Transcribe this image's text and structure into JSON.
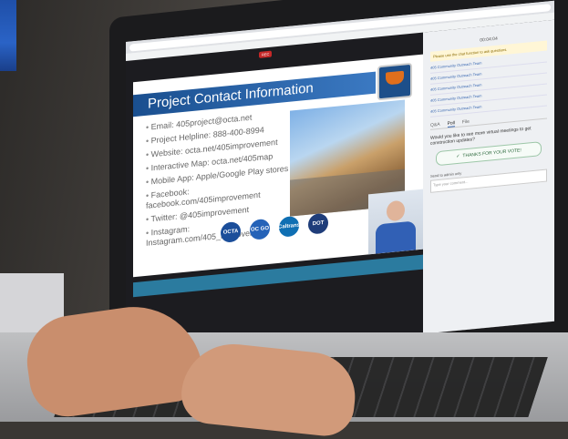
{
  "scene": {
    "description_colors": {
      "wall": "#4a4642",
      "laptop": "#1b1b1d"
    }
  },
  "webinar": {
    "live_label": "REC",
    "timer": "00:04:04",
    "slide": {
      "title": "Project Contact Information",
      "bullets": [
        "Email: 405project@octa.net",
        "Project Helpline: 888-400-8994",
        "Website: octa.net/405improvement",
        "Interactive Map: octa.net/405map",
        "Mobile App: Apple/Google Play stores",
        "Facebook: facebook.com/405improvement",
        "Twitter: @405improvement",
        "Instagram: Instagram.com/405_improvement"
      ],
      "logos": [
        "OCTA",
        "OC GO",
        "Caltrans",
        "DOT"
      ]
    },
    "side_panel": {
      "notice": "Please use the chat function to ask questions.",
      "messages": [
        {
          "sender": "405 Community Outreach Team",
          "body": ""
        },
        {
          "sender": "405 Community Outreach Team",
          "body": ""
        },
        {
          "sender": "405 Community Outreach Team",
          "body": ""
        },
        {
          "sender": "405 Community Outreach Team",
          "body": ""
        },
        {
          "sender": "405 Community Outreach Team",
          "body": ""
        }
      ],
      "tabs": [
        "Q&A",
        "Poll",
        "File"
      ],
      "poll_question": "Would you like to see more virtual meetings to get construction updates?",
      "poll_thanks": "THANKS FOR YOUR VOTE!",
      "send_to_label": "Send to admin only",
      "chat_placeholder": "Type your comment..."
    }
  }
}
